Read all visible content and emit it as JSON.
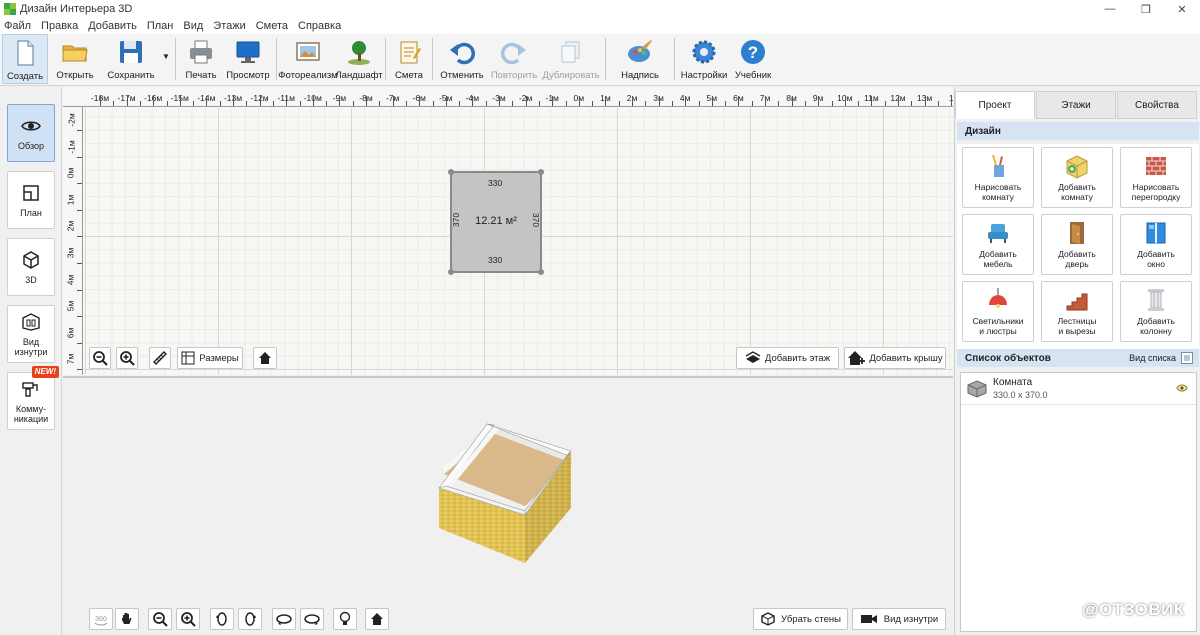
{
  "window": {
    "title": "Дизайн Интерьера 3D",
    "controls": {
      "minimize": "—",
      "restore": "❐",
      "close": "✕"
    }
  },
  "menu": [
    "Файл",
    "Правка",
    "Добавить",
    "План",
    "Вид",
    "Этажи",
    "Смета",
    "Справка"
  ],
  "toolbar": {
    "create": "Создать",
    "open": "Открыть",
    "save": "Сохранить",
    "print": "Печать",
    "preview": "Просмотр",
    "photoreal": "Фотореализм",
    "landscape": "Ландшафт",
    "estimate": "Смета",
    "undo": "Отменить",
    "redo": "Повторить",
    "duplicate": "Дублировать",
    "label": "Надпись",
    "settings": "Настройки",
    "tutorial": "Учебник"
  },
  "left_panel": {
    "overview": "Обзор",
    "plan": "План",
    "view3d": "3D",
    "inside_line1": "Вид",
    "inside_line2": "изнутри",
    "comm_line1": "Комму-",
    "comm_line2": "никации",
    "new_badge": "NEW!"
  },
  "plan": {
    "ruler_top": [
      "-18м",
      "-17м",
      "-16м",
      "-15м",
      "-14м",
      "-13м",
      "-12м",
      "-11м",
      "-10м",
      "-9м",
      "-8м",
      "-7м",
      "-6м",
      "-5м",
      "-4м",
      "-3м",
      "-2м",
      "-1м",
      "0м",
      "1м",
      "2м",
      "3м",
      "4м",
      "5м",
      "6м",
      "7м",
      "8м",
      "9м",
      "10м",
      "11м",
      "12м",
      "13м",
      "1"
    ],
    "ruler_left": [
      "-2м",
      "-1м",
      "0м",
      "1м",
      "2м",
      "3м",
      "4м",
      "5м",
      "6м",
      "7м"
    ],
    "room": {
      "top_dim": "330",
      "bottom_dim": "330",
      "left_dim": "370",
      "right_dim": "370",
      "area": "12.21 м²"
    },
    "dimensions_btn": "Размеры",
    "add_floor_btn": "Добавить этаж",
    "add_roof_btn": "Добавить крышу"
  },
  "view3d": {
    "remove_walls_btn": "Убрать стены",
    "inside_view_btn": "Вид изнутри"
  },
  "right_panel": {
    "tabs": [
      "Проект",
      "Этажи",
      "Свойства"
    ],
    "design_header": "Дизайн",
    "design_buttons": [
      {
        "l1": "Нарисовать",
        "l2": "комнату"
      },
      {
        "l1": "Добавить",
        "l2": "комнату"
      },
      {
        "l1": "Нарисовать",
        "l2": "перегородку"
      },
      {
        "l1": "Добавить",
        "l2": "мебель"
      },
      {
        "l1": "Добавить",
        "l2": "дверь"
      },
      {
        "l1": "Добавить",
        "l2": "окно"
      },
      {
        "l1": "Светильники",
        "l2": "и люстры"
      },
      {
        "l1": "Лестницы",
        "l2": "и вырезы"
      },
      {
        "l1": "Добавить",
        "l2": "колонну"
      }
    ],
    "objects_header": "Список объектов",
    "list_view_label": "Вид списка",
    "objects": [
      {
        "name": "Комната",
        "size": "330.0 x 370.0"
      }
    ]
  },
  "watermark": "@ОТЗОВИК",
  "colors": {
    "accent": "#cfe1f5",
    "section_header": "#d5e3f2",
    "room_fill": "#c4c4c4",
    "wall_yellow": "#e4c65a",
    "floor_wood": "#d9b98a"
  }
}
